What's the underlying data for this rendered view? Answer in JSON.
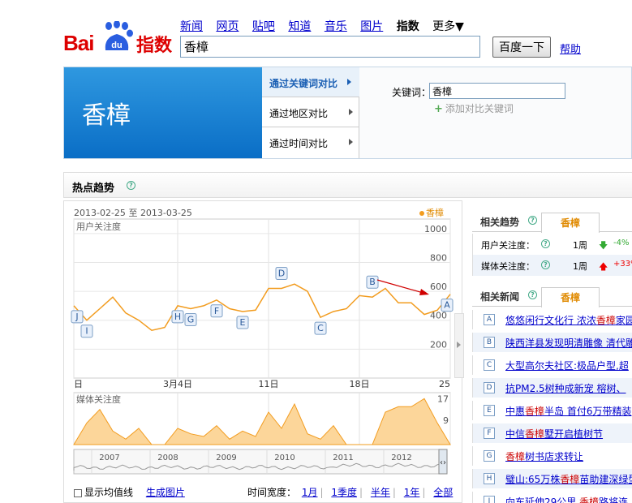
{
  "logo": {
    "brand_text": "Bai",
    "du_text": "du",
    "product": "指数"
  },
  "nav": {
    "items": [
      "新闻",
      "网页",
      "贴吧",
      "知道",
      "音乐",
      "图片"
    ],
    "current": "指数",
    "more": "更多▼"
  },
  "search": {
    "value": "香樟",
    "button": "百度一下",
    "help": "帮助"
  },
  "keyword_banner": "香樟",
  "compare_tabs": [
    {
      "label": "通过关键词对比",
      "active": true
    },
    {
      "label": "通过地区对比",
      "active": false
    },
    {
      "label": "通过时间对比",
      "active": false
    }
  ],
  "keyword_field": {
    "label": "关键词：",
    "value": "香樟",
    "add_label": "添加对比关键词"
  },
  "hot_trend": {
    "title": "热点趋势"
  },
  "chart_panel": {
    "date_from": "2013-02-25",
    "date_sep": "至",
    "date_to": "2013-03-25",
    "legend": "香樟",
    "show_avg_label": "显示均值线",
    "gen_image_label": "生成图片",
    "time_width_label": "时间宽度：",
    "time_options": [
      "1月",
      "1季度",
      "半年",
      "1年",
      "全部"
    ]
  },
  "chart_data": [
    {
      "type": "line",
      "ylabel": "用户关注度",
      "ylim": [
        0,
        1100
      ],
      "yticks": [
        200,
        400,
        600,
        800,
        1000
      ],
      "xtick_labels": [
        "日",
        "3月4日",
        "11日",
        "18日",
        "25"
      ],
      "x": [
        "2013-02-24",
        "2013-02-25",
        "2013-02-26",
        "2013-02-27",
        "2013-02-28",
        "2013-03-01",
        "2013-03-02",
        "2013-03-03",
        "2013-03-04",
        "2013-03-05",
        "2013-03-06",
        "2013-03-07",
        "2013-03-08",
        "2013-03-09",
        "2013-03-10",
        "2013-03-11",
        "2013-03-12",
        "2013-03-13",
        "2013-03-14",
        "2013-03-15",
        "2013-03-16",
        "2013-03-17",
        "2013-03-18",
        "2013-03-19",
        "2013-03-20",
        "2013-03-21",
        "2013-03-22",
        "2013-03-23",
        "2013-03-24",
        "2013-03-25"
      ],
      "values": [
        500,
        400,
        480,
        560,
        450,
        400,
        330,
        350,
        500,
        480,
        500,
        540,
        480,
        460,
        470,
        620,
        620,
        650,
        600,
        420,
        460,
        480,
        570,
        560,
        620,
        520,
        520,
        440,
        470,
        580
      ],
      "markers": [
        {
          "label": "J",
          "x": "2013-02-24"
        },
        {
          "label": "I",
          "x": "2013-02-25"
        },
        {
          "label": "H",
          "x": "2013-03-04"
        },
        {
          "label": "G",
          "x": "2013-03-05"
        },
        {
          "label": "F",
          "x": "2013-03-07"
        },
        {
          "label": "E",
          "x": "2013-03-09"
        },
        {
          "label": "D",
          "x": "2013-03-12"
        },
        {
          "label": "C",
          "x": "2013-03-15"
        },
        {
          "label": "B",
          "x": "2013-03-19"
        },
        {
          "label": "A",
          "x": "2013-03-25"
        }
      ]
    },
    {
      "type": "area",
      "ylabel": "媒体关注度",
      "ylim": [
        0,
        18
      ],
      "yticks": [
        9,
        17
      ],
      "x": [
        "2013-02-24",
        "2013-02-25",
        "2013-02-26",
        "2013-02-27",
        "2013-02-28",
        "2013-03-01",
        "2013-03-02",
        "2013-03-03",
        "2013-03-04",
        "2013-03-05",
        "2013-03-06",
        "2013-03-07",
        "2013-03-08",
        "2013-03-09",
        "2013-03-10",
        "2013-03-11",
        "2013-03-12",
        "2013-03-13",
        "2013-03-14",
        "2013-03-15",
        "2013-03-16",
        "2013-03-17",
        "2013-03-18",
        "2013-03-19",
        "2013-03-20",
        "2013-03-21",
        "2013-03-22",
        "2013-03-23",
        "2013-03-24",
        "2013-03-25"
      ],
      "values": [
        0,
        8,
        13,
        5,
        2,
        6,
        0,
        0,
        6,
        4,
        3,
        7,
        2,
        5,
        3,
        12,
        6,
        15,
        4,
        2,
        7,
        0,
        0,
        0,
        12,
        14,
        14,
        17,
        8,
        0
      ]
    },
    {
      "type": "area",
      "x_labels": [
        "2007",
        "2008",
        "2009",
        "2010",
        "2011",
        "2012"
      ]
    }
  ],
  "related_trend": {
    "title": "相关趋势",
    "keyword_tab": "香樟",
    "rows": [
      {
        "label": "用户关注度：",
        "period": "1周",
        "direction": "down",
        "change": "-4%"
      },
      {
        "label": "媒体关注度：",
        "period": "1周",
        "direction": "up",
        "change": "+33%"
      }
    ]
  },
  "related_news": {
    "title": "相关新闻",
    "keyword_tab": "香樟",
    "items": [
      {
        "mark": "A",
        "pre": "悠悠闲行文化行 浓浓",
        "hl": "香樟",
        "post": "家园"
      },
      {
        "mark": "B",
        "pre": "陕西洋县发现明清雕像 清代雕",
        "hl": "",
        "post": ""
      },
      {
        "mark": "C",
        "pre": "大型高尔夫社区:极品户型,超",
        "hl": "",
        "post": ""
      },
      {
        "mark": "D",
        "pre": "抗PM2.5树种成新宠 榕树、",
        "hl": "",
        "post": ""
      },
      {
        "mark": "E",
        "pre": "中惠",
        "hl": "香樟",
        "post": "半岛 首付6万带精装"
      },
      {
        "mark": "F",
        "pre": "中信",
        "hl": "香樟",
        "post": "墅开启植树节"
      },
      {
        "mark": "G",
        "pre": "",
        "hl": "香樟",
        "post": "树书店求转让"
      },
      {
        "mark": "H",
        "pre": "璧山:65万株",
        "hl": "香樟",
        "post": "苗助建深绿型"
      },
      {
        "mark": "I",
        "pre": "向东延伸29公里 ",
        "hl": "香樟",
        "post": "路将连上"
      }
    ]
  },
  "colors": {
    "line": "#f29c1f",
    "area": "#fcd69a",
    "accent_blue": "#0a6ec6",
    "arrow": "#d00000"
  }
}
